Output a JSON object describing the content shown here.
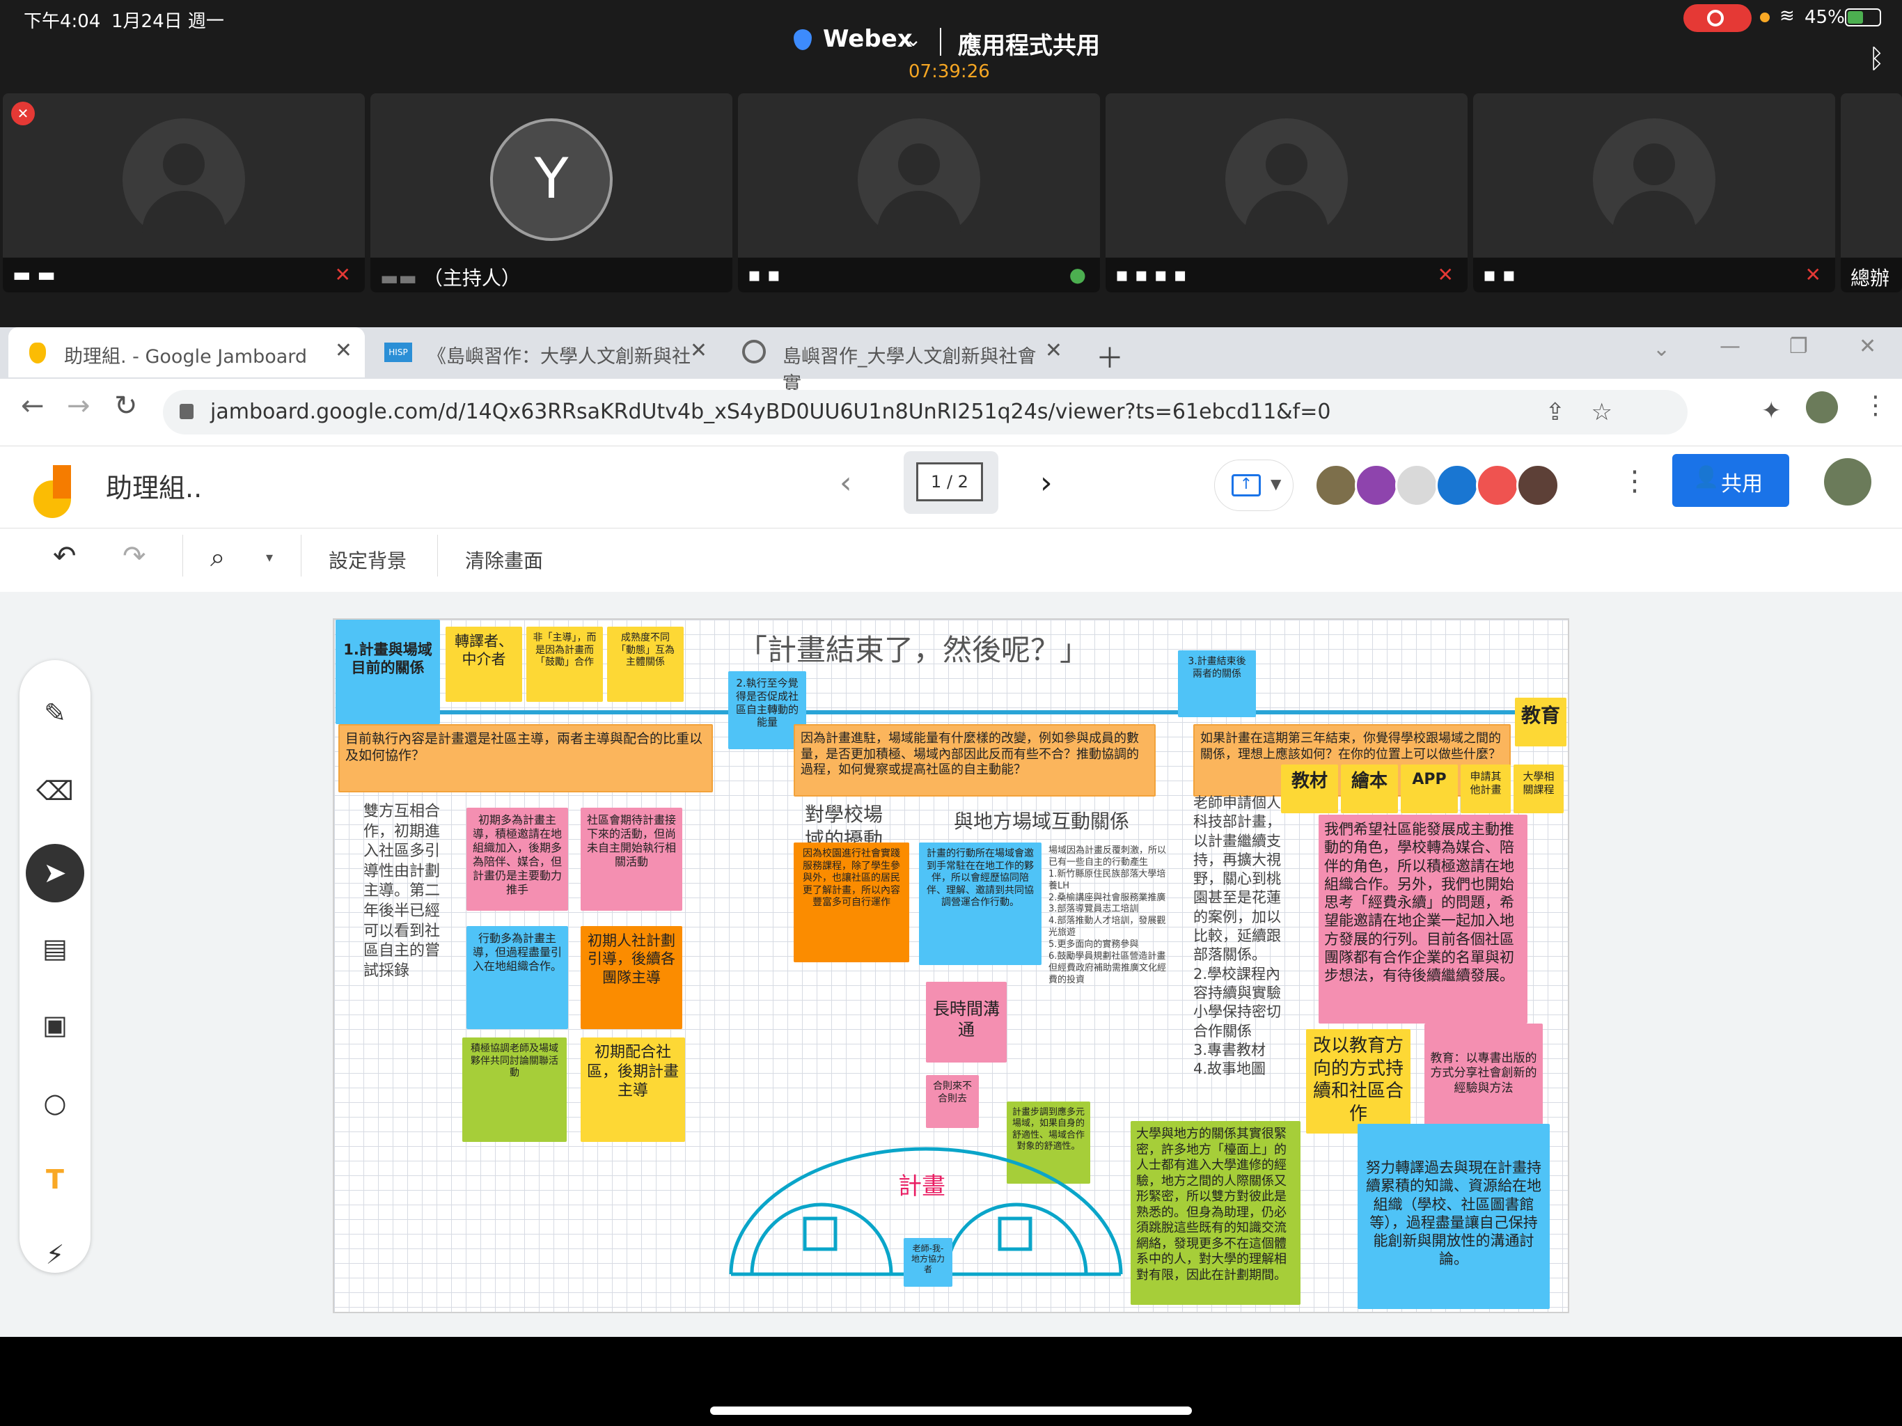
{
  "status_bar": {
    "time": "下午4:04",
    "date": "1月24日 週一",
    "battery": "45%"
  },
  "webex": {
    "app": "Webex",
    "mode": "應用程式共用",
    "timer": "07:39:26"
  },
  "participants": [
    {
      "name": "▬ ▬",
      "avatar": "person-icon",
      "mic": "muted"
    },
    {
      "name": "（主持人）",
      "avatar": "Y",
      "mic": "none"
    },
    {
      "name": "▪ ▪",
      "avatar": "person-icon",
      "mic": "on"
    },
    {
      "name": "▪ ▪ ▪ ▪",
      "avatar": "person-icon",
      "mic": "muted"
    },
    {
      "name": "▪ ▪",
      "avatar": "person-icon",
      "mic": "muted"
    },
    {
      "name": "總辦_",
      "avatar": "person-icon",
      "mic": "none"
    }
  ],
  "tabs": [
    {
      "label": "助理組. - Google Jamboard"
    },
    {
      "label": "《島嶼習作：大學人文創新與社"
    },
    {
      "label": "島嶼習作_大學人文創新與社會實"
    }
  ],
  "address": {
    "url": "jamboard.google.com/d/14Qx63RRsaKRdUtv4b_xS4yBD0UU6U1n8UnRI251q24s/viewer?ts=61ebcd11&f=0"
  },
  "jamboard": {
    "title": "助理組..",
    "frame": "1 / 2",
    "share_label": "共用",
    "toolbar": {
      "set_bg": "設定背景",
      "clear": "清除畫面"
    },
    "board": {
      "title": "「計畫結束了，然後呢？」",
      "notes": {
        "n1": "1.計畫與場域目前的關係",
        "n2": "轉譯者、中介者",
        "n3": "非「主導」，而是因為計畫而「鼓勵」合作",
        "n4": "成熟度不同「動態」互為主體關係",
        "n5": "2.執行至今覺得是否促成社區自主轉動的能量",
        "n6": "3.計畫結束後兩者的關係",
        "n7": "教育",
        "q1": "目前執行內容是計畫還是社區主導，兩者主導與配合的比重以及如何協作？",
        "q2": "因為計畫進駐，場域能量有什麼樣的改變，例如參與成員的數量，是否更加積極、場域內部因此反而有些不合？推動協調的過程，如何覺察或提高社區的自主動能？",
        "q3": "如果計畫在這期第三年結束，你覺得學校跟場域之間的關係，理想上應該如何？在你的位置上可以做些什麼？",
        "t1": "雙方互相合作，初期進入社區多引導性由計劃主導。第二年後半已經可以看到社區自主的嘗試採錄",
        "p1": "初期多為計畫主導，積極邀請在地組織加入，後期多為陪伴、媒合，但計畫仍是主要動力推手",
        "p2": "社區會期待計畫接下來的活動，但尚未自主開始執行相關活動",
        "b1": "行動多為計畫主導，但過程盡量引入在地組織合作。",
        "o1": "初期人社計劃引導，後續各團隊主導",
        "g1": "積極協調老師及場域夥伴共同討論關聯活動",
        "y1": "初期配合社區，後期計畫主導",
        "h1": "對學校場域的擾動",
        "h2": "與地方場域互動關係",
        "od": "因為校園進行社會實踐服務課程，除了學生參與外，也讓社區的居民更了解計畫，所以內容豐富多可自行運作",
        "bl": "計畫的行動所在場域會邀到手常駐在在地工作的夥伴，所以會經歷協同陪伴、理解、邀請到共同協調營運合作行動。",
        "lt": "長時間溝通",
        "sm": "合則來不合則去",
        "gs": "計畫步調到應多元場域，如果自身的舒適性、場域合作對象的舒適性。",
        "bullets": "場域因為計畫反覆刺激，所以已有一些自主的行動產生\n1.新竹縣原住民族部落大學培養LH\n2.桑榆講座與社會服務業推廣\n3.部落導覽員志工培訓\n4.部落推動人才培訓，發展觀光旅遊\n5.更多面向的實務參與\n6.鼓勵學員規劃社區營造計畫\n但經費政府補助需推廣文化經費的投資",
        "t2": "老師申請個人科技部計畫，以計畫繼續支持，再擴大視野，關心到桃園甚至是花蓮的案例，加以比較，延續跟部落關係。\n2.學校課程內容持續與實驗小學保持密切合作關係\n3.專書教材\n4.故事地圖",
        "tags": [
          "教材",
          "繪本",
          "APP",
          "申請其他計畫",
          "大學相關課程"
        ],
        "pk1": "我們希望社區能發展成主動推動的角色，學校轉為媒合、陪伴的角色，所以積極邀請在地組織合作。另外，我們也開始思考「經費永續」的問題，希望能邀請在地企業一起加入地方發展的行列。目前各個社區團隊都有合作企業的名單與初步想法，有待後續繼續發展。",
        "yl": "改以教育方向的方式持續和社區合作",
        "pk2": "教育：以專書出版的方式分享社會創新的經驗與方法",
        "gb": "大學與地方的關係其實很緊密，許多地方「檯面上」的人士都有進入大學進修的經驗，地方之間的人際關係又形緊密，所以雙方對彼此是熟悉的。但身為助理，仍必須跳脫這些既有的知識交流網絡，發現更多不在這個體系中的人，對大學的理解相對有限，因此在計劃期間。",
        "bb": "努力轉譯過去與現在計畫持續累積的知識、資源給在地組織（學校、社區圖書館等），過程盡量讓自己保持能創新與開放性的溝通討論。",
        "plan": "計畫",
        "ts": "老師-我-地方協力者"
      }
    }
  },
  "colors": {
    "jam_yellow": "#fbbc04",
    "share_blue": "#1a73e8",
    "note_blue": "#4fc3f7",
    "note_pink": "#f48fb1"
  }
}
